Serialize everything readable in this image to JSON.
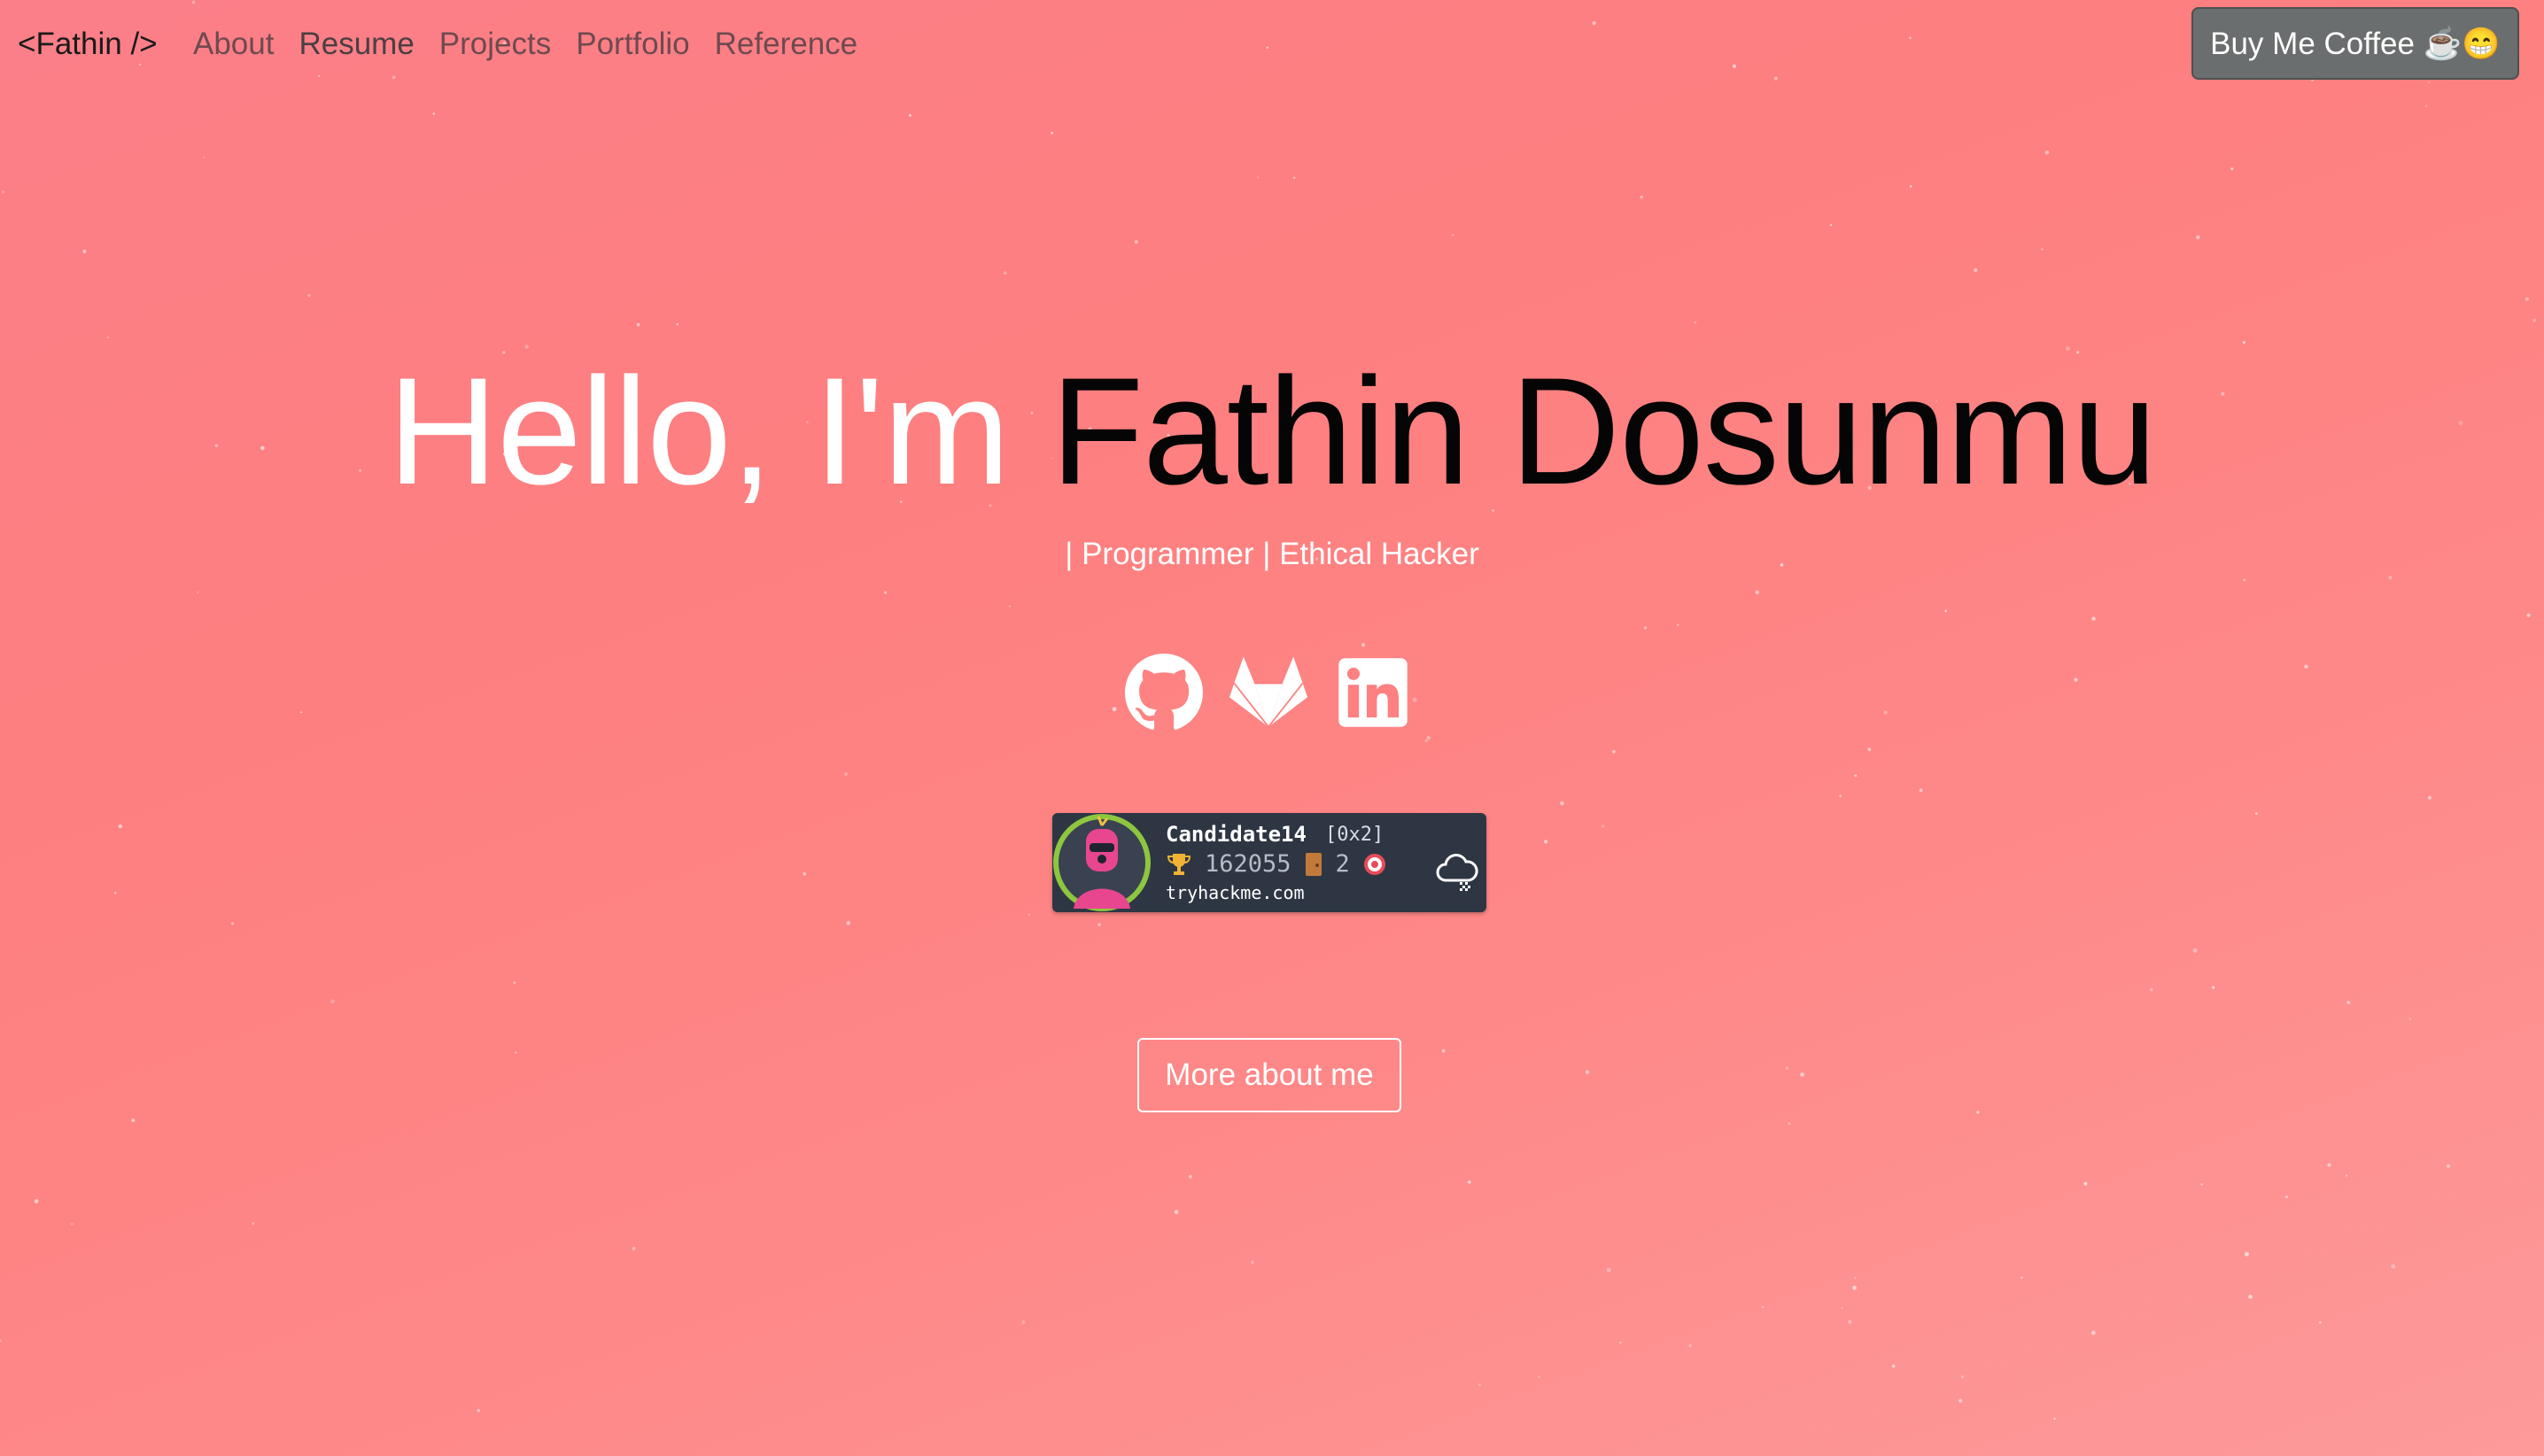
{
  "nav": {
    "brand": "<Fathin />",
    "links": [
      "About",
      "Resume",
      "Projects",
      "Portfolio",
      "Reference"
    ],
    "cta": "Buy Me Coffee ☕😁"
  },
  "hero": {
    "greeting": "Hello, I'm ",
    "name": "Fathin Dosunmu",
    "subtitle": "| Programmer | Ethical Hacker"
  },
  "socials": [
    {
      "icon": "github-icon"
    },
    {
      "icon": "gitlab-icon"
    },
    {
      "icon": "linkedin-icon"
    }
  ],
  "tryhackme_badge": {
    "username": "Candidate14",
    "rank": "[0x2]",
    "points": "162055",
    "rooms": "2",
    "domain": "tryhackme.com"
  },
  "more_button": "More about me",
  "colors": {
    "background_top": "#fb7f89",
    "background_bottom": "#fd9a9a",
    "name_text": "#050505",
    "coffee_button": "#6b6e6e",
    "badge_background": "#2e3643"
  }
}
